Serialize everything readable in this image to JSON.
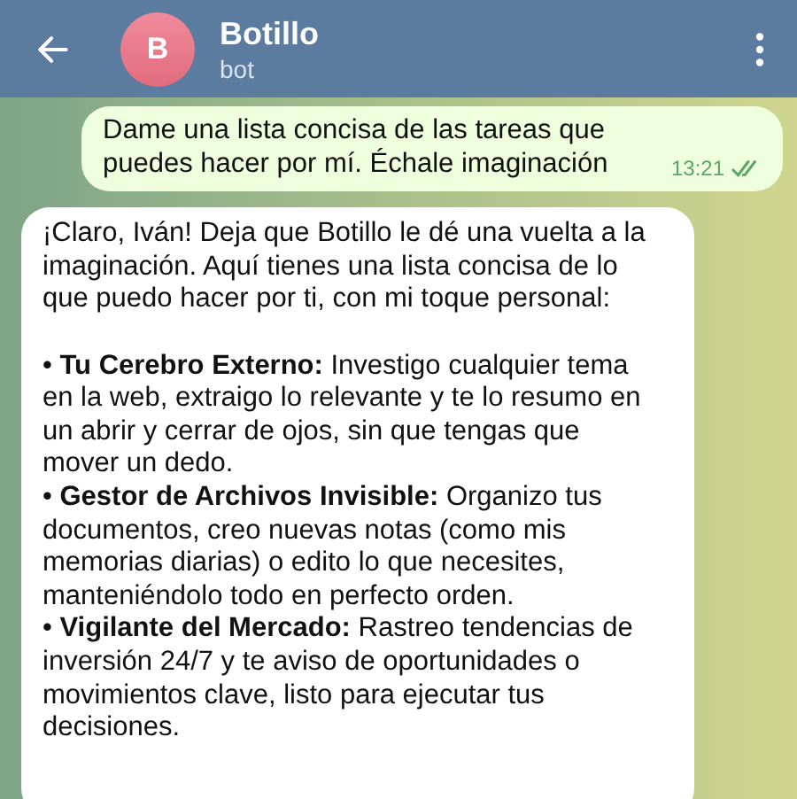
{
  "header": {
    "title": "Botillo",
    "subtitle": "bot",
    "avatar_letter": "B"
  },
  "messages": [
    {
      "kind": "outgoing",
      "text": "Dame una lista concisa de las tareas que puedes hacer por mí. Échale imaginación",
      "time": "13:21",
      "read": true
    },
    {
      "kind": "incoming",
      "paragraphs": [
        "¡Claro, Iván! Deja que Botillo le dé una vuelta a la imaginación. Aquí tienes una lista concisa de lo que puedo hacer por ti, con mi toque personal:"
      ],
      "items": [
        "• **Tu Cerebro Externo:** Investigo cualquier tema en la web, extraigo lo relevante y te lo resumo en un abrir y cerrar de ojos, sin que tengas que mover un dedo.",
        "• **Gestor de Archivos Invisible:** Organizo tus documentos, creo nuevas notas (como mis memorias diarias) o edito lo que necesites, manteniéndolo todo en perfecto orden.",
        "• **Vigilante del Mercado:** Rastreo tendencias de inversión 24/7 y te aviso de oportunidades o movimientos clave, listo para ejecutar tus decisiones."
      ]
    }
  ]
}
